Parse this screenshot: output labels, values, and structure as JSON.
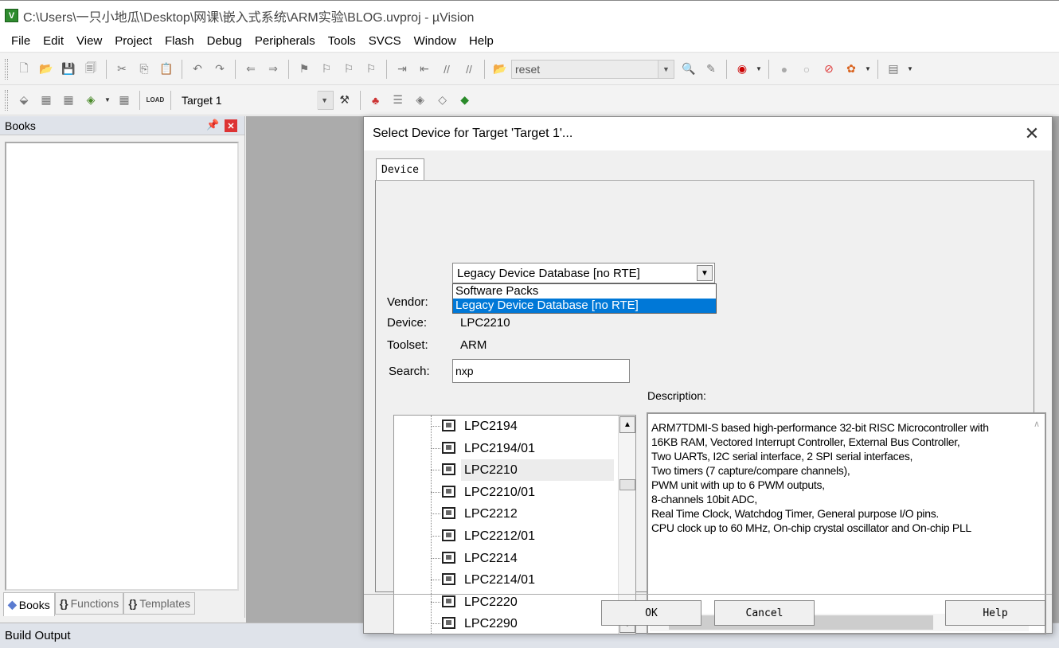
{
  "window": {
    "title": "C:\\Users\\一只小地瓜\\Desktop\\网课\\嵌入式系统\\ARM实验\\BLOG.uvproj - µVision",
    "app_icon_letter": "V"
  },
  "menu": [
    "File",
    "Edit",
    "View",
    "Project",
    "Flash",
    "Debug",
    "Peripherals",
    "Tools",
    "SVCS",
    "Window",
    "Help"
  ],
  "toolbar": {
    "combo_value": "reset",
    "target": "Target 1"
  },
  "books_panel": {
    "title": "Books",
    "tabs": [
      {
        "icon": "books-icon",
        "label": "Books"
      },
      {
        "icon": "{}",
        "label": "Functions"
      },
      {
        "icon": "{}+",
        "label": "Templates"
      }
    ]
  },
  "build_output": {
    "title": "Build Output"
  },
  "dialog": {
    "title": "Select Device for Target 'Target 1'...",
    "tab": "Device",
    "vendor_select_value": "Legacy Device Database [no RTE]",
    "vendor_options": [
      "Software Packs",
      "Legacy Device Database [no RTE]"
    ],
    "vendor_label": "Vendor:",
    "device_label": "Device:",
    "device_value": "LPC2210",
    "toolset_label": "Toolset:",
    "toolset_value": "ARM",
    "search_label": "Search:",
    "search_value": "nxp",
    "description_label": "Description:",
    "devices": [
      "LPC2194",
      "LPC2194/01",
      "LPC2210",
      "LPC2210/01",
      "LPC2212",
      "LPC2212/01",
      "LPC2214",
      "LPC2214/01",
      "LPC2220",
      "LPC2290"
    ],
    "selected_device": "LPC2210",
    "description": "ARM7TDMI-S based high-performance 32-bit RISC Microcontroller with\n16KB RAM, Vectored Interrupt Controller, External Bus Controller,\nTwo UARTs, I2C serial interface,  2 SPI serial interfaces,\nTwo timers  (7 capture/compare channels),\nPWM unit with up to 6 PWM outputs,\n8-channels 10bit ADC,\nReal Time Clock, Watchdog Timer, General purpose I/O pins.\nCPU clock up to 60 MHz, On-chip crystal oscillator and On-chip PLL",
    "buttons": {
      "ok": "OK",
      "cancel": "Cancel",
      "help": "Help"
    }
  },
  "colors": {
    "selection": "#0078d7",
    "app_icon": "#2e8b2e",
    "close_red": "#dd3333",
    "workspace": "#ababab"
  }
}
